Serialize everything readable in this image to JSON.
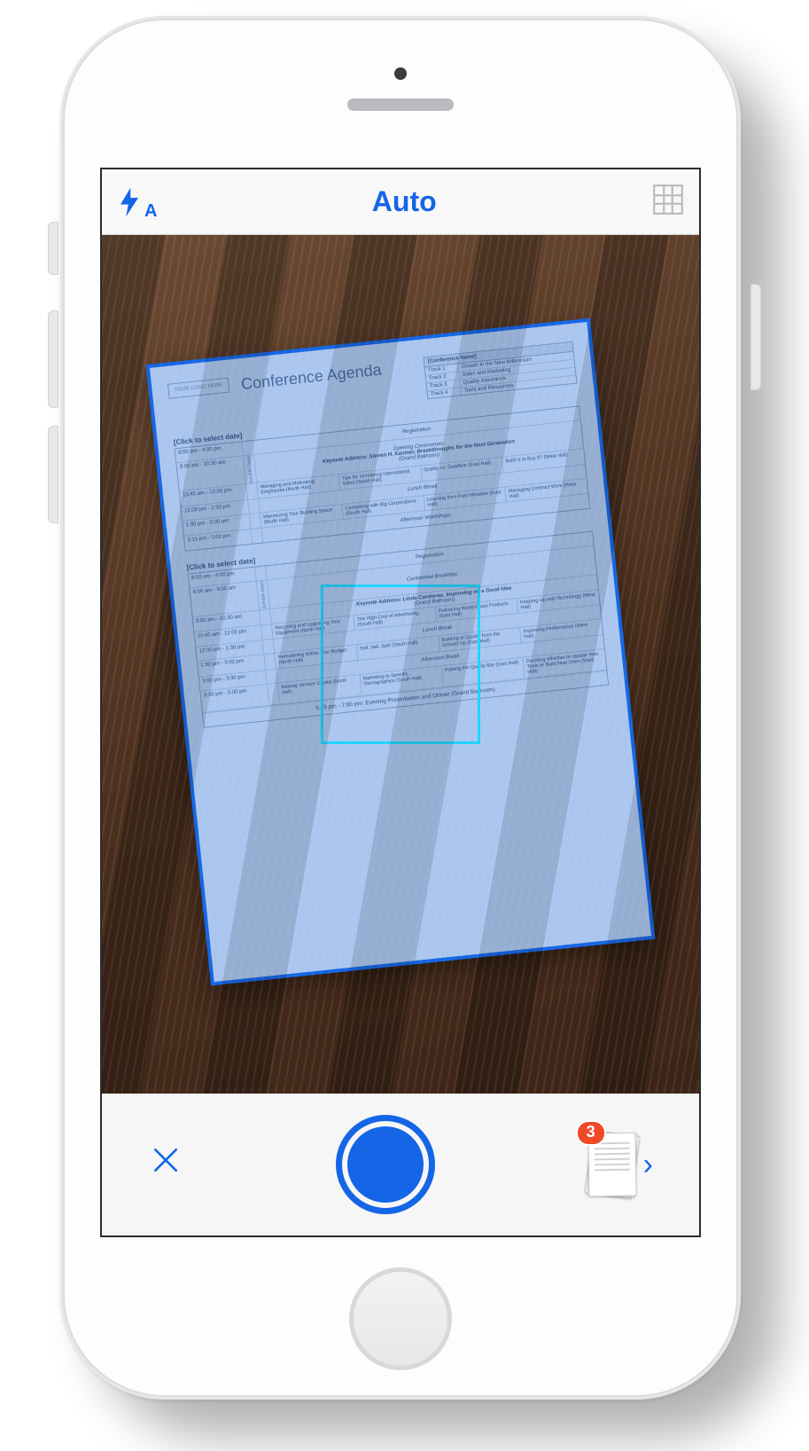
{
  "colors": {
    "accent": "#1466e6",
    "badge": "#ef4a27",
    "focus": "#1fd3ff"
  },
  "topbar": {
    "flash_mode_sub": "A",
    "capture_mode": "Auto"
  },
  "bottombar": {
    "scan_count": "3"
  },
  "document": {
    "logo_placeholder": "YOUR LOGO HERE",
    "title": "Conference Agenda",
    "conference_name_label": "[Conference Name]",
    "tracks": [
      {
        "id": "Track 1",
        "name": "Growth in the New Millennium"
      },
      {
        "id": "Track 2",
        "name": "Sales and Marketing"
      },
      {
        "id": "Track 3",
        "name": "Quality Assurance"
      },
      {
        "id": "Track 4",
        "name": "Tools and Resources"
      }
    ],
    "exhibits_label": "Exhibits Open",
    "days": [
      {
        "date_label": "[Click to select date]",
        "rows": [
          {
            "time": "8:00 am - 4:00 pm",
            "span": "Registration"
          },
          {
            "time": "9:00 am - 10:30 am",
            "span_lines": [
              "Opening Ceremonies",
              "Keynote Address: Steven H. Kastner, Breakthroughs for the Next Generation",
              "(Grand Ballroom)"
            ]
          },
          {
            "time": "10:45 am - 12:00 pm",
            "sessions": [
              "Managing and Motivating Employees (North Hall)",
              "Tips for Increasing International Sales (South Hall)",
              "Quality vs. Deadline (East Hall)",
              "Build It or Buy It? (West Hall)"
            ]
          },
          {
            "time": "12:00 pm - 1:30 pm",
            "span": "Lunch Break"
          },
          {
            "time": "1:30 pm - 3:00 pm",
            "sessions": [
              "Maximizing Your Building Space (North Hall)",
              "Competing with Big Corporations (South Hall)",
              "Learning from Past Mistakes (East Hall)",
              "Managing Contract Work (West Hall)"
            ]
          },
          {
            "time": "3:15 pm - 5:00 pm",
            "span": "Afternoon Workshops"
          }
        ]
      },
      {
        "date_label": "[Click to select date]",
        "rows": [
          {
            "time": "8:00 am - 4:00 pm",
            "span": "Registration"
          },
          {
            "time": "8:00 am - 9:00 am",
            "span": "Continental Breakfast"
          },
          {
            "time": "9:00 am - 10:30 am",
            "span_lines": [
              "Keynote Address: Linda Contreras, Improving on a Good Idea",
              "(Grand Ballroom)"
            ]
          },
          {
            "time": "10:45 am - 12:00 pm",
            "sessions": [
              "Recycling and Upgrading Your Equipment (North Hall)",
              "The High Cost of Advertising (South Hall)",
              "Delivering World-Class Products (East Hall)",
              "Keeping Up with Technology (West Hall)"
            ]
          },
          {
            "time": "12:00 pm - 1:30 pm",
            "span": "Lunch Break"
          },
          {
            "time": "1:30 pm - 3:00 pm",
            "sessions": [
              "Remodeling Within Your Budget (North Hall)",
              "Sell, Sell, Sell! (South Hall)",
              "Building In Quality from the Ground Up (East Hall)",
              "Improving Performance (West Hall)"
            ]
          },
          {
            "time": "3:00 pm - 3:30 pm",
            "span": "Afternoon Break"
          },
          {
            "time": "3:30 pm - 5:00 pm",
            "sessions": [
              "Raising Venture Capital (North Hall)",
              "Marketing to Specific Demographics (South Hall)",
              "Raising the Quality Bar (East Hall)",
              "Deciding Whether to Update Your Tools or Build New Ones (West Hall)"
            ]
          },
          {
            "time": "5:15 pm - 7:00 pm",
            "span": "Evening Presentation and Dinner (Grand Ballroom)"
          }
        ]
      }
    ]
  }
}
